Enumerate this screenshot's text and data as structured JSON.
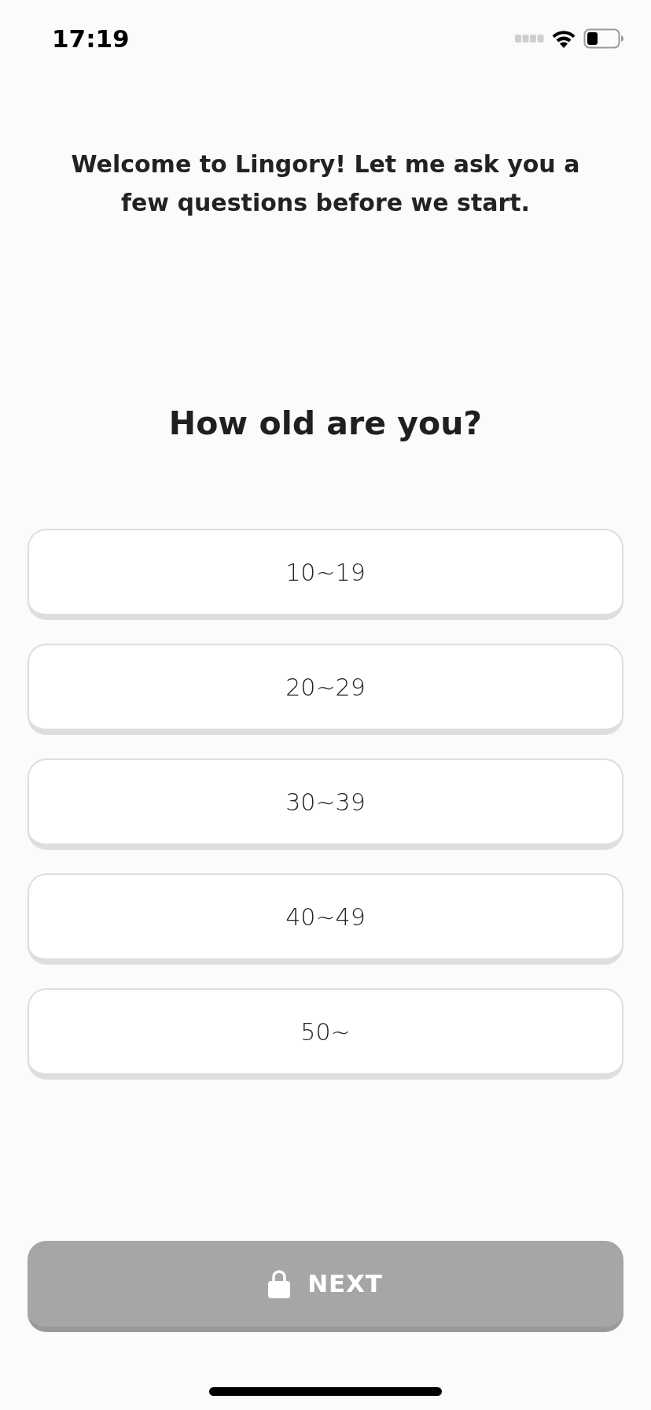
{
  "status_bar": {
    "time": "17:19"
  },
  "intro": "Welcome to Lingory! Let me ask you a few questions before we start.",
  "question": "How old are you?",
  "options": [
    {
      "label": "10~19",
      "selected": false
    },
    {
      "label": "20~29",
      "selected": false
    },
    {
      "label": "30~39",
      "selected": false
    },
    {
      "label": "40~49",
      "selected": false
    },
    {
      "label": "50~",
      "selected": false
    }
  ],
  "next_button": {
    "label": "NEXT",
    "disabled": true
  }
}
